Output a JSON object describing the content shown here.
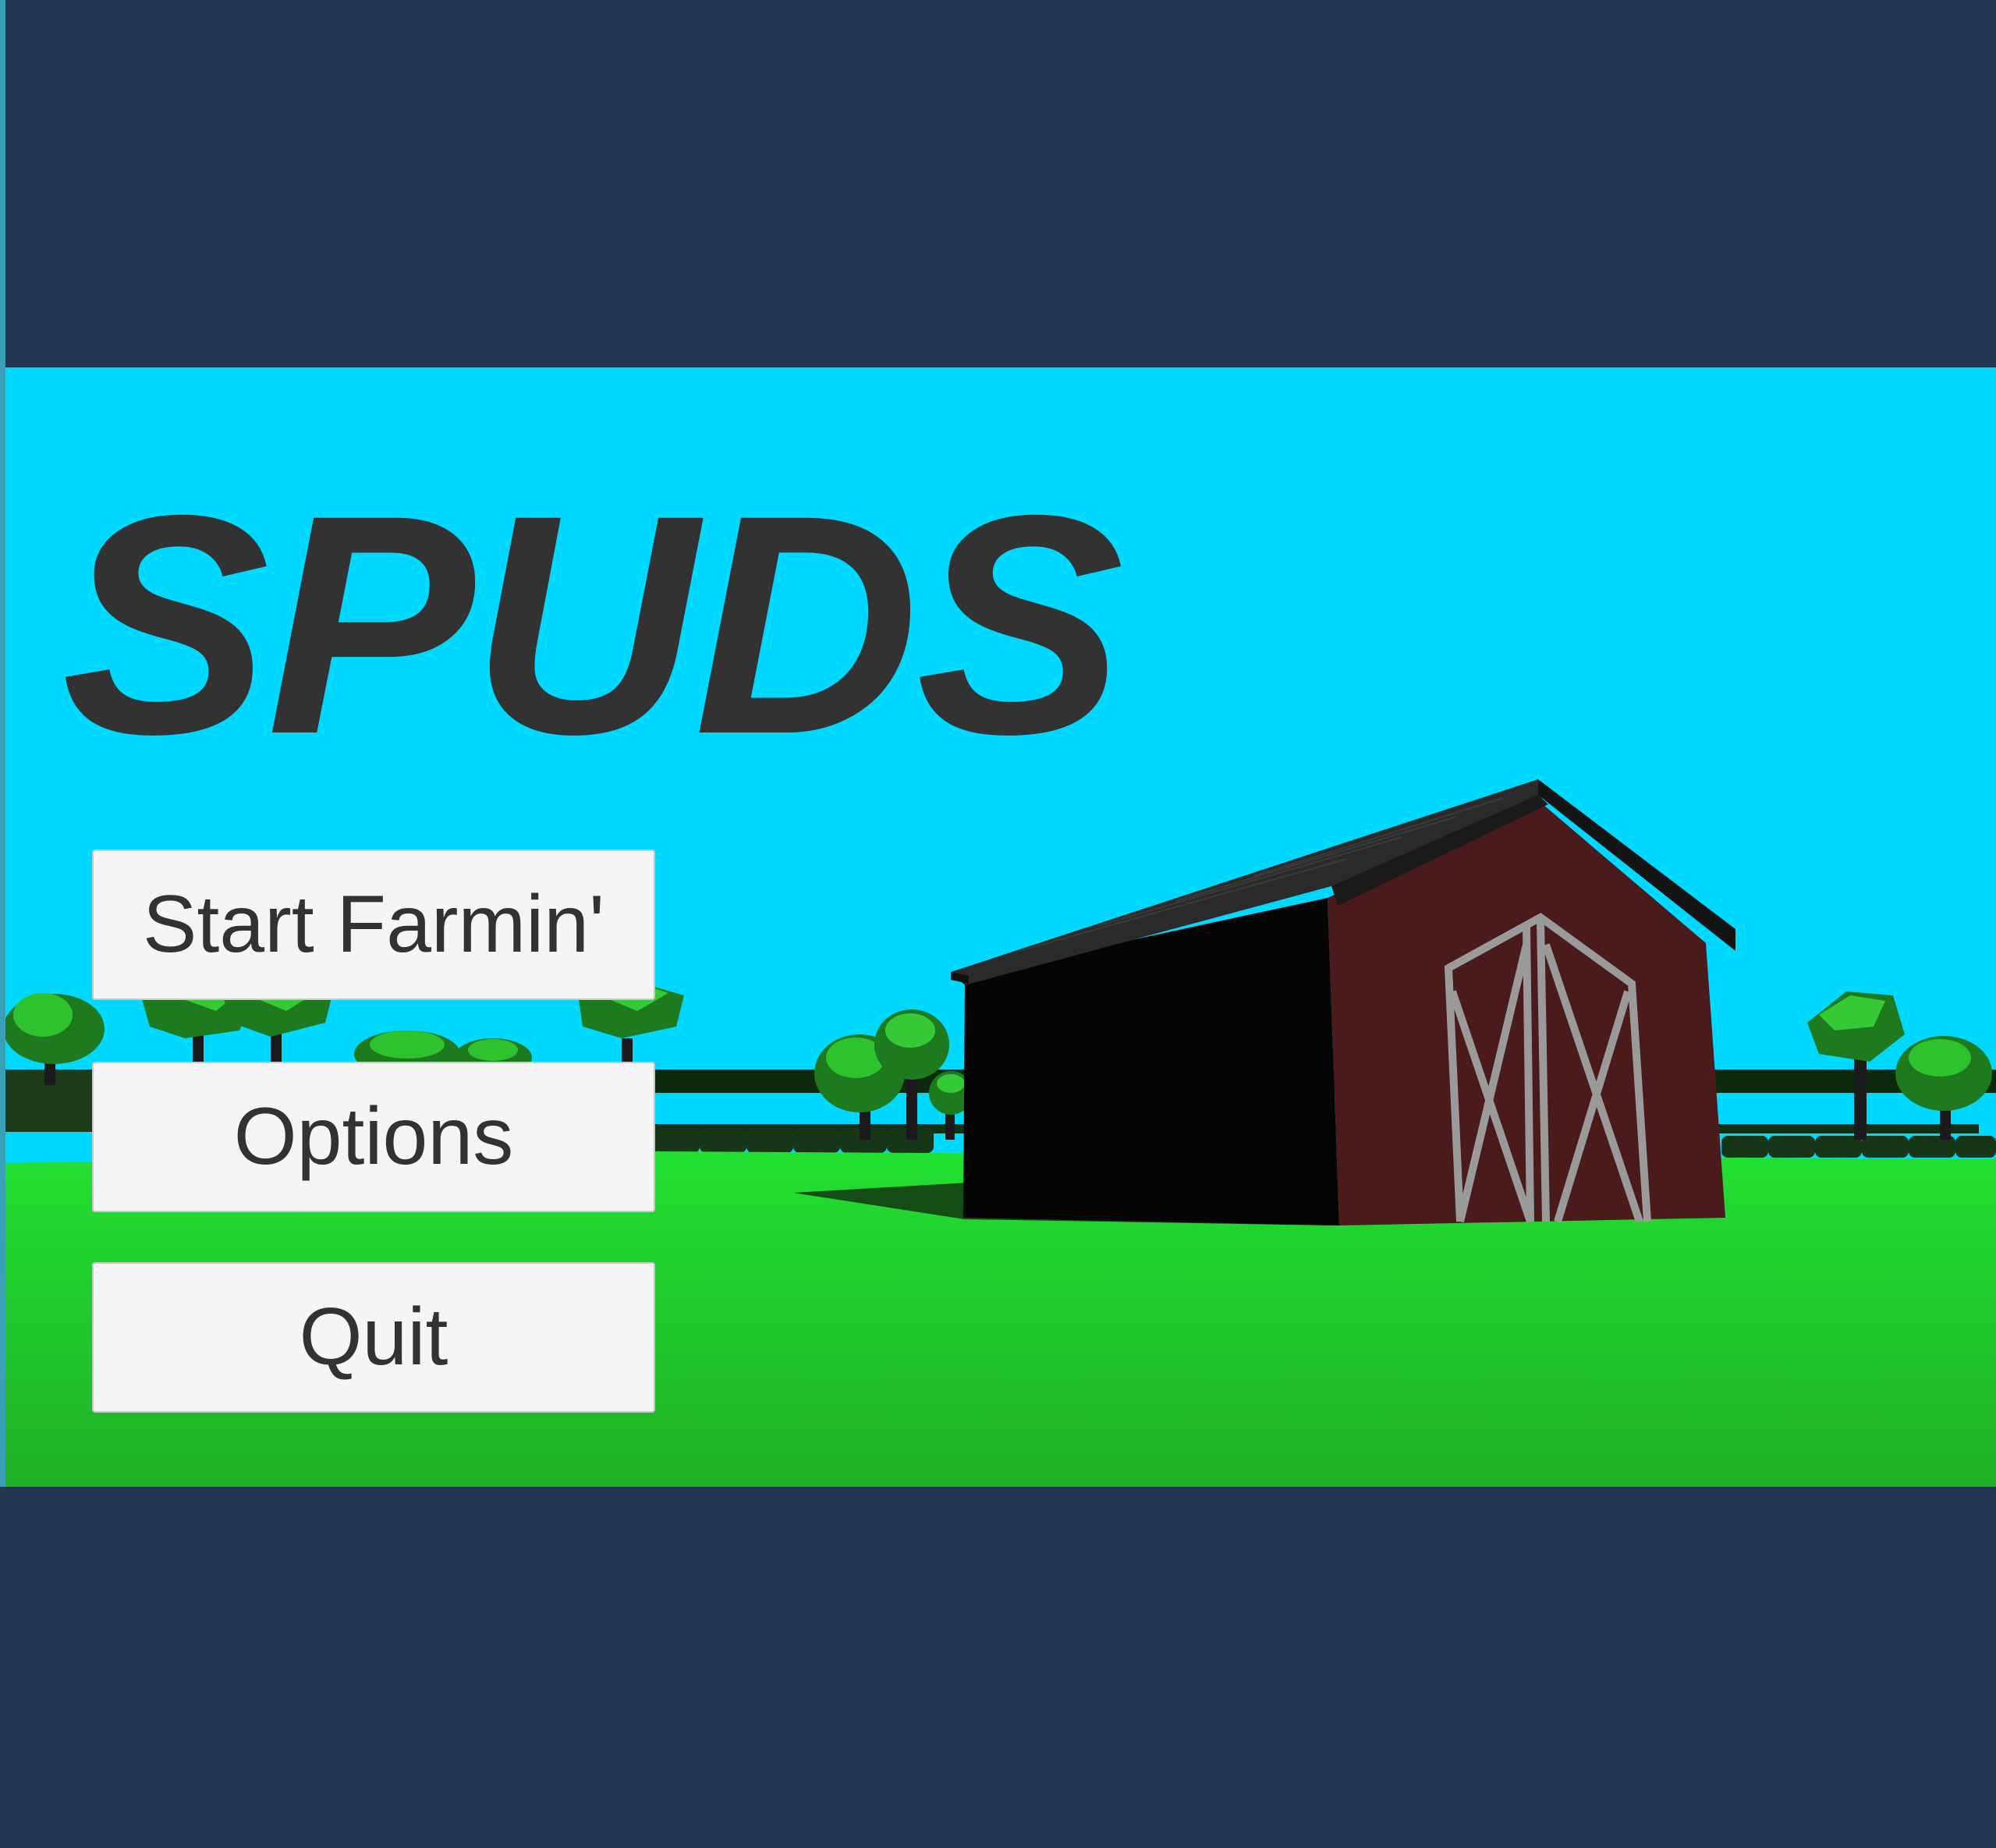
{
  "game": {
    "title": "SPUDS"
  },
  "menu": {
    "start_label": "Start Farmin'",
    "options_label": "Options",
    "quit_label": "Quit"
  },
  "colors": {
    "letterbox": "#243650",
    "sky": "#00d9ff",
    "grass_light": "#22e032",
    "grass_dark": "#1fb026",
    "barn_red": "#4b1a1a",
    "barn_roof": "#2a2a2a",
    "title_text": "#323232",
    "button_bg": "#f5f5f5"
  }
}
